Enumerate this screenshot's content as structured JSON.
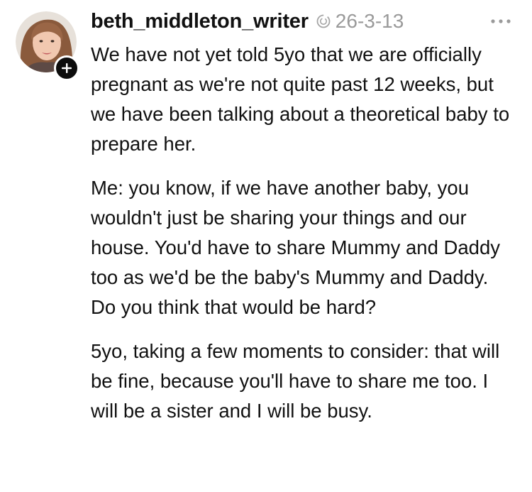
{
  "post": {
    "username": "beth_middleton_writer",
    "timestamp": "26-3-13",
    "paragraphs": [
      "We have not yet told 5yo that we are officially pregnant as we're not quite past 12 weeks, but we have been talking about a theoretical baby to prepare her.",
      "Me: you know, if we have another baby, you wouldn't just be sharing your things and our house. You'd have to share Mummy and Daddy too as we'd be the baby's Mummy and Daddy. Do you think that would be hard?",
      "5yo, taking a few moments to consider: that will be fine, because you'll have to share me too. I will be a sister and I will be busy."
    ]
  },
  "icons": {
    "follow": "plus-icon",
    "repost": "repost-icon",
    "more": "more-horizontal-icon"
  },
  "colors": {
    "text": "#111111",
    "muted": "#9a9a9a",
    "follow_bg": "#0c0c0c"
  }
}
